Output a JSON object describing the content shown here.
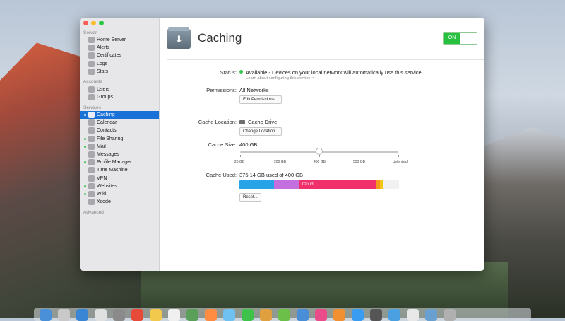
{
  "sidebar": {
    "sections": {
      "server": "Server",
      "accounts": "Accounts",
      "services": "Services",
      "advanced": "Advanced"
    },
    "server_items": [
      {
        "label": "Home Server",
        "icon": "server-icon"
      },
      {
        "label": "Alerts",
        "icon": "alert-icon"
      },
      {
        "label": "Certificates",
        "icon": "certificate-icon"
      },
      {
        "label": "Logs",
        "icon": "logs-icon"
      },
      {
        "label": "Stats",
        "icon": "stats-icon"
      }
    ],
    "account_items": [
      {
        "label": "Users",
        "icon": "user-icon"
      },
      {
        "label": "Groups",
        "icon": "groups-icon"
      }
    ],
    "service_items": [
      {
        "label": "Caching",
        "icon": "caching-icon",
        "on": true,
        "selected": true
      },
      {
        "label": "Calendar",
        "icon": "calendar-icon",
        "on": false
      },
      {
        "label": "Contacts",
        "icon": "contacts-icon",
        "on": false
      },
      {
        "label": "File Sharing",
        "icon": "file-sharing-icon",
        "on": true
      },
      {
        "label": "Mail",
        "icon": "mail-icon",
        "on": true
      },
      {
        "label": "Messages",
        "icon": "messages-icon",
        "on": false
      },
      {
        "label": "Profile Manager",
        "icon": "profile-manager-icon",
        "on": true
      },
      {
        "label": "Time Machine",
        "icon": "time-machine-icon",
        "on": false
      },
      {
        "label": "VPN",
        "icon": "vpn-icon",
        "on": false
      },
      {
        "label": "Websites",
        "icon": "websites-icon",
        "on": true
      },
      {
        "label": "Wiki",
        "icon": "wiki-icon",
        "on": true
      },
      {
        "label": "Xcode",
        "icon": "xcode-icon",
        "on": false
      }
    ]
  },
  "header": {
    "title": "Caching",
    "toggle_label": "ON",
    "toggle_color": "#27c13f"
  },
  "status": {
    "label": "Status:",
    "value": "Available - Devices on your local network will automatically use this service",
    "help": "Learn about configuring this service",
    "dot_color": "#36c451"
  },
  "permissions": {
    "label": "Permissions:",
    "value": "All Networks",
    "button": "Edit Permissions..."
  },
  "cache_location": {
    "label": "Cache Location:",
    "value": "Cache Drive",
    "button": "Change Location..."
  },
  "cache_size": {
    "label": "Cache Size:",
    "value": "400 GB",
    "ticks": [
      "25 GB",
      "200 GB",
      "400 GB",
      "550 GB",
      "Unlimited"
    ],
    "slider_position": 0.5
  },
  "cache_used": {
    "label": "Cache Used:",
    "value": "375.14 GB used of 400 GB",
    "segments": [
      {
        "label": "",
        "fraction": 0.215,
        "color": "#27a3e8"
      },
      {
        "label": "",
        "fraction": 0.155,
        "color": "#c36fdd"
      },
      {
        "label": "iCloud",
        "fraction": 0.49,
        "color": "#f0306a"
      },
      {
        "label": "",
        "fraction": 0.02,
        "color": "#f59a1a"
      },
      {
        "label": "",
        "fraction": 0.015,
        "color": "#f5c518"
      }
    ],
    "button": "Reset..."
  },
  "dock": {
    "apps": [
      "#4a90d9",
      "#c9c9c9",
      "#3a86d4",
      "#e0e0e0",
      "#8a8a8a",
      "#e84a3a",
      "#f2c94c",
      "#f0f0f0",
      "#5aa05a",
      "#ff8c42",
      "#6ec1f0",
      "#3ec24a",
      "#e0a040",
      "#6cc04a",
      "#4a8ed8",
      "#ea4c89",
      "#f09030",
      "#3a9cf0",
      "#555555",
      "#4aa0e0",
      "#e8e8e8",
      "#6aa0d0",
      "#b0b0b0"
    ]
  }
}
